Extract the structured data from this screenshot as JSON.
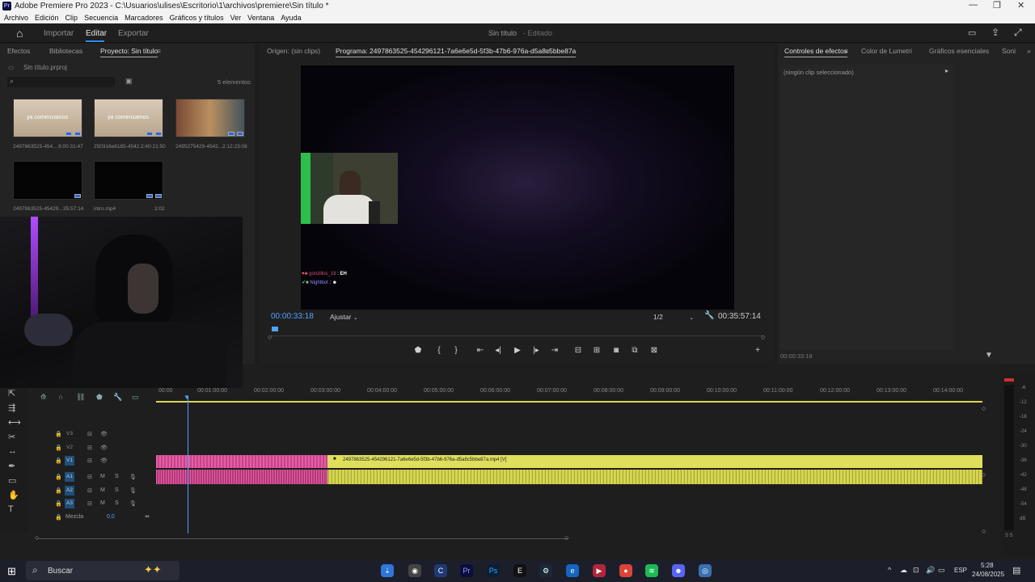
{
  "window": {
    "title": "Adobe Premiere Pro 2023 - C:\\Usuarios\\ulises\\Escritorio\\1\\archivos\\premiere\\Sin título *",
    "app_badge": "Pr"
  },
  "menu": [
    "Archivo",
    "Edición",
    "Clip",
    "Secuencia",
    "Marcadores",
    "Gráficos y títulos",
    "Ver",
    "Ventana",
    "Ayuda"
  ],
  "workspace": {
    "tabs": [
      "Importar",
      "Editar",
      "Exportar"
    ],
    "active": "Editar",
    "project_title": "Sin título",
    "project_state": "- Editado"
  },
  "project_panel": {
    "tabs": [
      "Efectos",
      "Bibliotecas",
      "Proyecto: Sin título"
    ],
    "project_file": "Sin título.prproj",
    "count": "5 elementos",
    "items": [
      {
        "name": "2497863525-454...",
        "duration": "8:00:31:47",
        "overlay": "ya comenzamos"
      },
      {
        "name": "250316e6185-4542...",
        "duration": "2:40:21:50",
        "overlay": "ya comenzamos"
      },
      {
        "name": "2495275429-4542...",
        "duration": "2:12:23:08",
        "overlay": ""
      },
      {
        "name": "2497863525-45429...",
        "duration": "35:57:14",
        "overlay": ""
      },
      {
        "name": "intro.mp4",
        "duration": "2:02",
        "overlay": ""
      }
    ]
  },
  "monitor": {
    "source_tab": "Origen: (sin clips)",
    "program_tab": "Programa: 2497863525-454296121-7a6e6e5d-5f3b-47b6-976a-d5a8c5bbe87a",
    "timecode": "00:00:33:18",
    "fit": "Ajustar",
    "resolution": "1/2",
    "duration": "00:35:57:14",
    "chat": [
      {
        "user": "gonzillos_18",
        "msg": "EH"
      },
      {
        "user": "Nightbot",
        "msg": ""
      }
    ]
  },
  "effect_controls": {
    "tabs": [
      "Controles de efectos",
      "Color de Lumetri",
      "Gráficos esenciales",
      "Soni"
    ],
    "empty": "(ningún clip seleccionado)",
    "timecode": "00:00:33:18"
  },
  "timeline": {
    "ruler": [
      "00:00",
      "00:01:00:00",
      "00:02:00:00",
      "00:03:00:00",
      "00:04:00:00",
      "00:05:00:00",
      "00:06:00:00",
      "00:07:00:00",
      "00:08:00:00",
      "00:09:00:00",
      "00:10:00:00",
      "00:11:00:00",
      "00:12:00:00",
      "00:13:00:00",
      "00:14:00:00"
    ],
    "video_tracks": [
      "V3",
      "V2",
      "V1"
    ],
    "audio_tracks": [
      "A1",
      "A2",
      "A3"
    ],
    "mix_label": "Mezcla",
    "mix_value": "0,0",
    "clip_label": "2497863525-454296121-7a6e6e5d-5f3b-47b6-976a-d5a8c5bbe87a.mp4 [V]",
    "meter_scale": [
      "-6",
      "-12",
      "-18",
      "-24",
      "-30",
      "-36",
      "-42",
      "-48",
      "-54",
      "dB"
    ],
    "meter_solo": "S S",
    "mute_label": "M",
    "solo_label": "S"
  },
  "taskbar": {
    "search": "Buscar",
    "lang": "ESP",
    "time": "5:28",
    "date": "24/08/2025"
  }
}
